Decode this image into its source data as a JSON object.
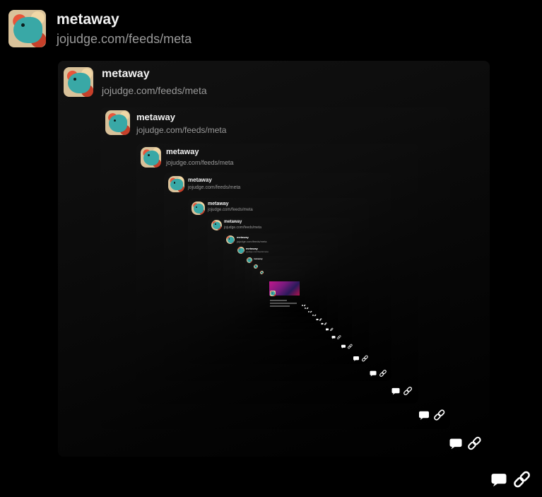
{
  "post": {
    "author": "metaway",
    "handle": "jojudge.com/feeds/meta"
  },
  "icons": {
    "avatar": "avatar-image",
    "reply": "speech-bubble-icon",
    "link": "chain-link-icon"
  },
  "colors": {
    "background": "#000000",
    "name": "#f2f2f2",
    "handle": "#9a9a9a",
    "icon": "#ffffff"
  }
}
